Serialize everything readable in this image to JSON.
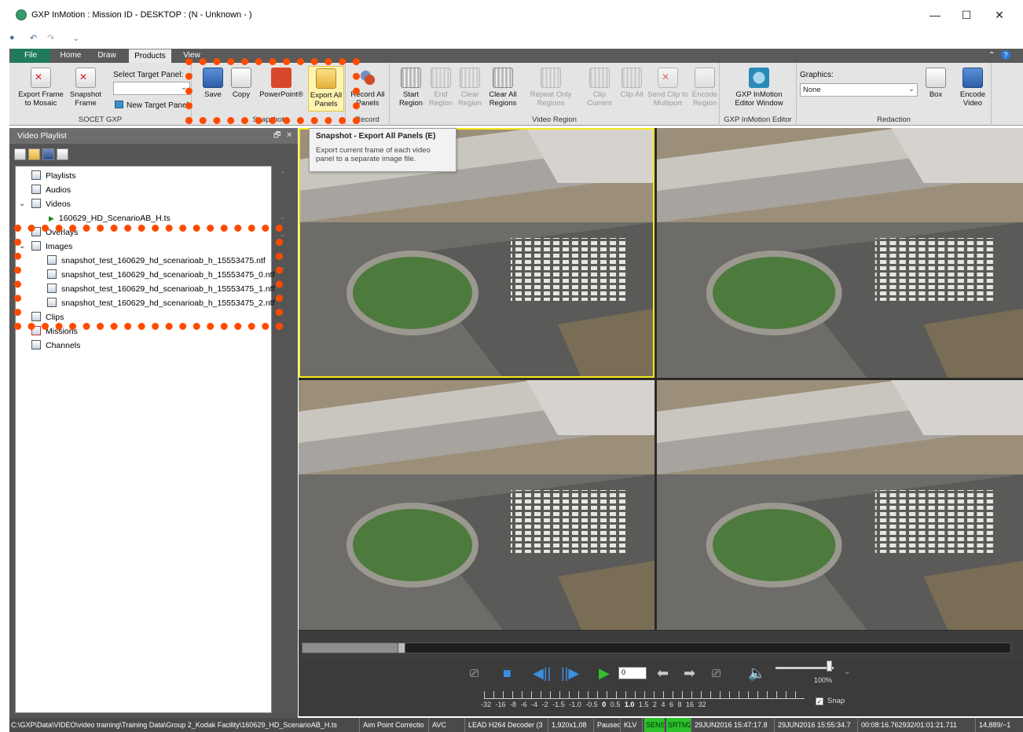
{
  "window": {
    "title": "GXP InMotion : Mission ID - DESKTOP : (N - Unknown - )",
    "minimize": "—",
    "maximize": "☐",
    "close": "✕"
  },
  "ribbon_tabs": [
    "File",
    "Home",
    "Draw",
    "Products",
    "View"
  ],
  "ribbon": {
    "socet": {
      "label": "SOCET GXP",
      "export_frame": "Export Frame to Mosaic",
      "snapshot_frame": "Snapshot Frame",
      "select_target_label": "Select Target Panel:",
      "new_target": "New Target Panel"
    },
    "snapshot": {
      "label": "Snapshot",
      "save": "Save",
      "copy": "Copy",
      "powerpoint": "PowerPoint®",
      "export_all": "Export All Panels"
    },
    "record": {
      "label": "Record",
      "record_all": "Record All Panels"
    },
    "region": {
      "label": "Video Region",
      "start": "Start Region",
      "end": "End Region",
      "clear": "Clear Region",
      "clear_all": "Clear All Regions",
      "repeat": "Repeat Only Regions",
      "clip_current": "Clip Current",
      "clip_all": "Clip All",
      "send_clip": "Send Clip to Multiport",
      "encode_region": "Encode Region"
    },
    "editor": {
      "label": "GXP InMotion Editor",
      "window": "GXP InMotion Editor Window"
    },
    "redaction": {
      "label": "Redaction",
      "graphics_label": "Graphics:",
      "graphics_value": "None",
      "box": "Box",
      "encode_video": "Encode Video"
    }
  },
  "tooltip": {
    "title": "Snapshot - Export All Panels (E)",
    "text": "Export current frame of each video panel to a separate image file."
  },
  "playlist": {
    "title": "Video Playlist",
    "pin": "🗗",
    "close": "✕",
    "nodes": {
      "playlists": "Playlists",
      "audios": "Audios",
      "videos": "Videos",
      "video_file": "160629_HD_ScenarioAB_H.ts",
      "overlays": "Overlays",
      "images": "Images",
      "img0": "snapshot_test_160629_hd_scenarioab_h_15553475.ntf",
      "img1": "snapshot_test_160629_hd_scenarioab_h_15553475_0.ntf",
      "img2": "snapshot_test_160629_hd_scenarioab_h_15553475_1.ntf",
      "img3": "snapshot_test_160629_hd_scenarioab_h_15553475_2.ntf",
      "clips": "Clips",
      "missions": "Missions",
      "channels": "Channels"
    }
  },
  "controls": {
    "frame_value": "0",
    "volume": "100%",
    "volume_level": 0.92,
    "timeline_position": 0.14,
    "speeds": [
      "-32",
      "-16",
      "-8",
      "-6",
      "-4",
      "-2",
      "-1.5",
      "-1.0",
      "-0.5",
      "0",
      "0.5",
      "1.0",
      "1.5",
      "2",
      "4",
      "6",
      "8",
      "16",
      "32"
    ],
    "snap_label": "Snap",
    "snap_checked": "✓"
  },
  "statusbar": {
    "path": "C:\\GXP\\Data\\VIDEO\\video training\\Training Data\\Group 2_Kodak Facility\\160629_HD_ScenarioAB_H.ts",
    "aim": "Aim Point Correctio",
    "codec": "AVC",
    "decoder": "LEAD H264 Decoder (3",
    "resolution": "1,920x1,08",
    "state": "Paused",
    "klv": "KLV",
    "sens": "SENS",
    "srtm": "SRTM2",
    "start": "29JUN2016 15:47:17.8",
    "end": "29JUN2016 15:55:34.7",
    "position": "00:08:16.762932/01:01:21.711",
    "frames": "14,889/~1"
  }
}
